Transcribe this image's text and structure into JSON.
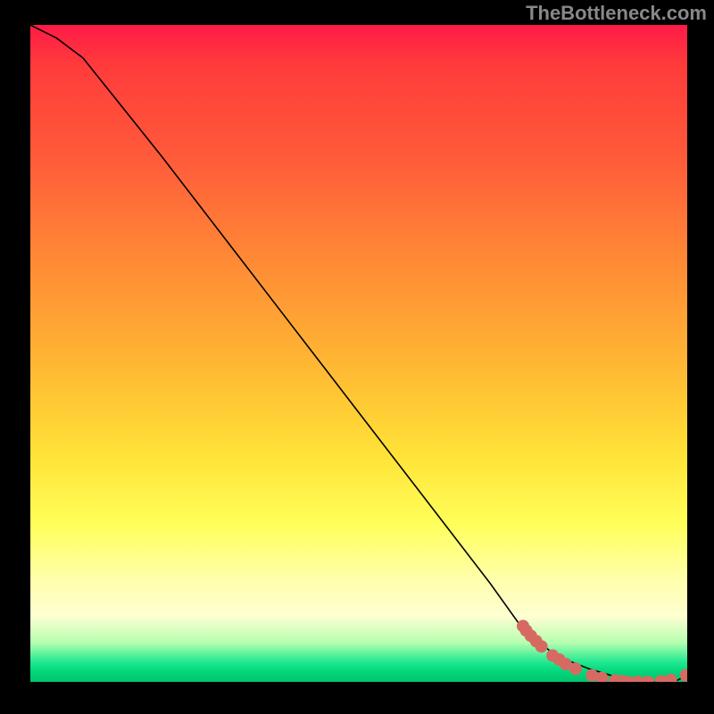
{
  "watermark": "TheBottleneck.com",
  "chart_data": {
    "type": "line",
    "title": "",
    "xlabel": "",
    "ylabel": "",
    "x": [
      0.0,
      0.04,
      0.08,
      0.12,
      0.2,
      0.3,
      0.4,
      0.5,
      0.6,
      0.7,
      0.75,
      0.8,
      0.85,
      0.9,
      0.94,
      0.96,
      0.98,
      1.0
    ],
    "y": [
      1.0,
      0.98,
      0.95,
      0.9,
      0.8,
      0.67,
      0.54,
      0.41,
      0.28,
      0.15,
      0.08,
      0.04,
      0.02,
      0.005,
      0.0,
      0.0,
      0.0,
      0.01
    ],
    "xlim": [
      0,
      1
    ],
    "ylim": [
      0,
      1
    ],
    "gradient_stops": [
      {
        "pos": 0.0,
        "color": "#ff1a47"
      },
      {
        "pos": 0.5,
        "color": "#ffb833"
      },
      {
        "pos": 0.8,
        "color": "#ffff5a"
      },
      {
        "pos": 0.97,
        "color": "#20e890"
      },
      {
        "pos": 1.0,
        "color": "#00c46c"
      }
    ],
    "markers": {
      "color": "#d66a63",
      "radius_px": 7,
      "points": [
        {
          "x": 0.75,
          "y": 0.085
        },
        {
          "x": 0.755,
          "y": 0.078
        },
        {
          "x": 0.762,
          "y": 0.07
        },
        {
          "x": 0.77,
          "y": 0.062
        },
        {
          "x": 0.778,
          "y": 0.054
        },
        {
          "x": 0.795,
          "y": 0.04
        },
        {
          "x": 0.805,
          "y": 0.034
        },
        {
          "x": 0.815,
          "y": 0.027
        },
        {
          "x": 0.83,
          "y": 0.02
        },
        {
          "x": 0.855,
          "y": 0.01
        },
        {
          "x": 0.87,
          "y": 0.006
        },
        {
          "x": 0.89,
          "y": 0.002
        },
        {
          "x": 0.9,
          "y": 0.001
        },
        {
          "x": 0.91,
          "y": 0.0
        },
        {
          "x": 0.925,
          "y": 0.0
        },
        {
          "x": 0.94,
          "y": 0.0
        },
        {
          "x": 0.96,
          "y": 0.001
        },
        {
          "x": 0.975,
          "y": 0.003
        },
        {
          "x": 0.998,
          "y": 0.01
        }
      ]
    }
  }
}
